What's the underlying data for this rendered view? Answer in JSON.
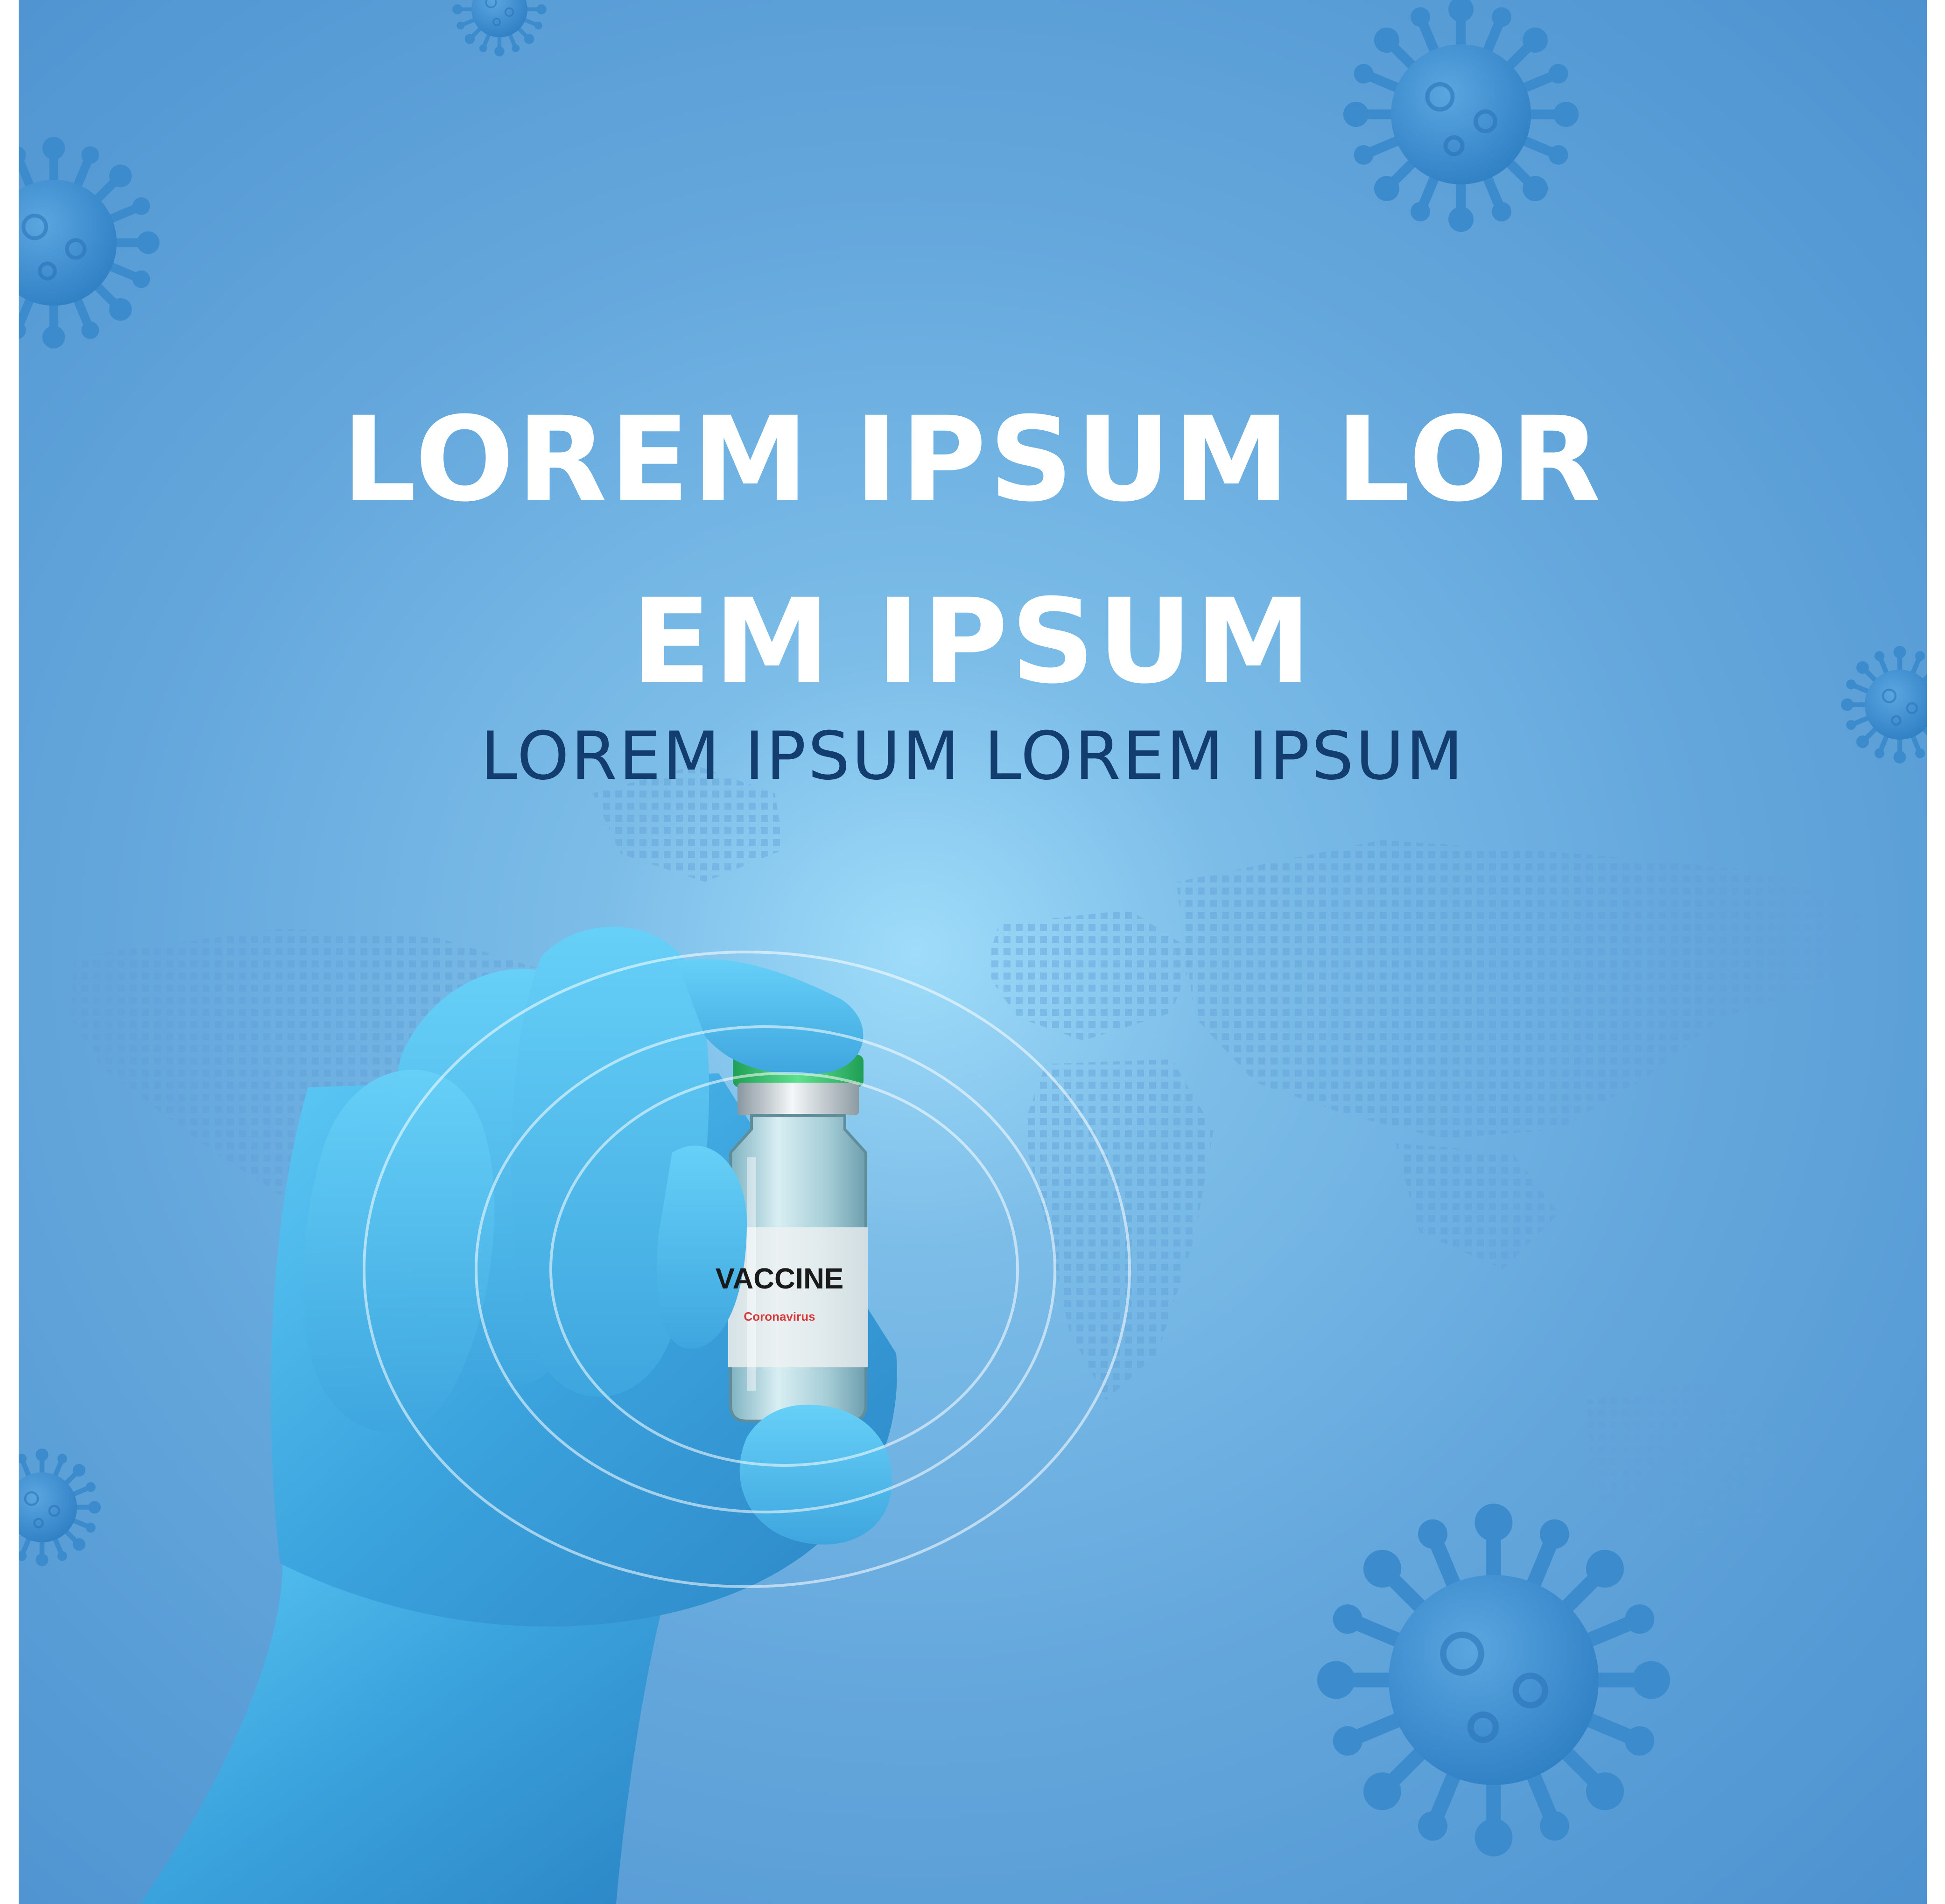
{
  "headline": {
    "line1": "LOREM IPSUM LOR",
    "line2": "EM IPSUM"
  },
  "subheadline": "LOREM IPSUM LOREM IPSUM",
  "vial": {
    "title": "VACCINE",
    "subtitle": "Coronavirus"
  },
  "colors": {
    "background": "#64a7dc",
    "headline": "#ffffff",
    "subheadline": "#123d6e",
    "glove": "#3aa2dc",
    "virus": "#3f8fd0",
    "vial_cap": "#2fbf6a",
    "vial_label_text": "#d83a3a"
  },
  "icons": [
    "virus-icon",
    "world-map-dots",
    "gloved-hand",
    "vaccine-vial"
  ]
}
